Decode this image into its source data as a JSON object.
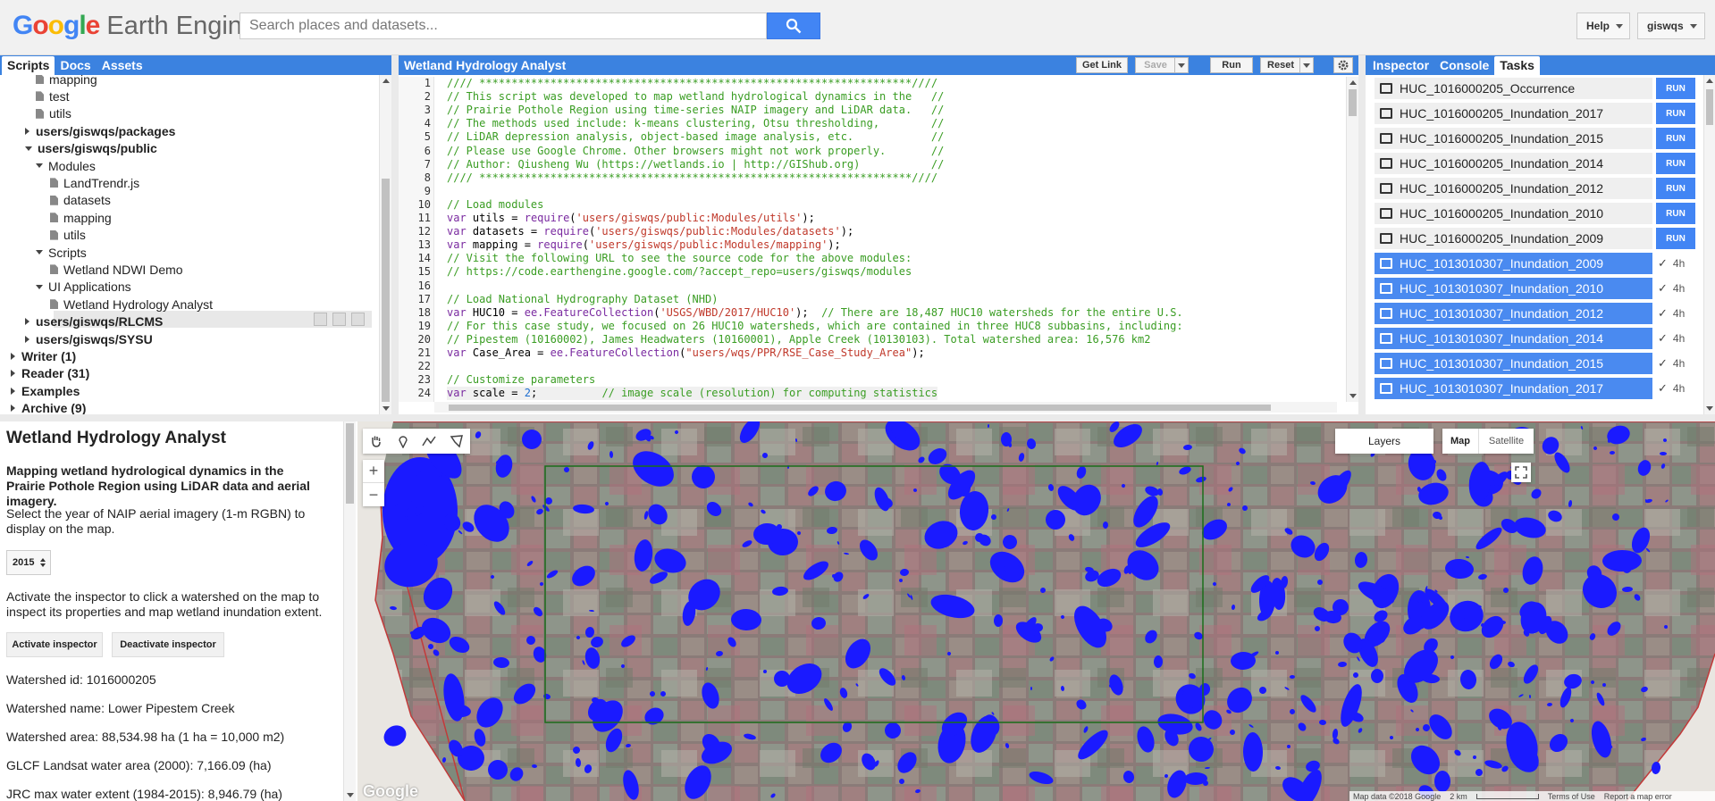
{
  "app": {
    "logo_google": "Google",
    "logo_product": "Earth Engine",
    "search_placeholder": "Search places and datasets...",
    "help_label": "Help",
    "user_label": "giswqs"
  },
  "left_panel": {
    "tabs": [
      "Scripts",
      "Docs",
      "Assets"
    ],
    "tree": [
      {
        "label": "mapping",
        "kind": "file",
        "depth": 3,
        "bold": false
      },
      {
        "label": "test",
        "kind": "file",
        "depth": 3,
        "bold": false
      },
      {
        "label": "utils",
        "kind": "file",
        "depth": 3,
        "bold": false
      },
      {
        "label": "users/giswqs/packages",
        "kind": "collapsed",
        "depth": 2,
        "bold": true
      },
      {
        "label": "users/giswqs/public",
        "kind": "expanded",
        "depth": 2,
        "bold": true
      },
      {
        "label": "Modules",
        "kind": "expanded",
        "depth": 3,
        "bold": false
      },
      {
        "label": "LandTrendr.js",
        "kind": "file",
        "depth": 4,
        "bold": false
      },
      {
        "label": "datasets",
        "kind": "file",
        "depth": 4,
        "bold": false
      },
      {
        "label": "mapping",
        "kind": "file",
        "depth": 4,
        "bold": false
      },
      {
        "label": "utils",
        "kind": "file",
        "depth": 4,
        "bold": false
      },
      {
        "label": "Scripts",
        "kind": "expanded",
        "depth": 3,
        "bold": false
      },
      {
        "label": "Wetland NDWI Demo",
        "kind": "file",
        "depth": 4,
        "bold": false
      },
      {
        "label": "UI Applications",
        "kind": "expanded",
        "depth": 3,
        "bold": false
      },
      {
        "label": "Wetland Hydrology Analyst",
        "kind": "file",
        "depth": 4,
        "bold": false
      },
      {
        "label": "users/giswqs/RLCMS",
        "kind": "collapsed",
        "depth": 2,
        "bold": true
      },
      {
        "label": "users/giswqs/SYSU",
        "kind": "collapsed",
        "depth": 2,
        "bold": true
      },
      {
        "label": "Writer (1)",
        "kind": "collapsed",
        "depth": 1,
        "bold": true
      },
      {
        "label": "Reader (31)",
        "kind": "collapsed",
        "depth": 1,
        "bold": true
      },
      {
        "label": "Examples",
        "kind": "collapsed",
        "depth": 1,
        "bold": true
      },
      {
        "label": "Archive (9)",
        "kind": "collapsed",
        "depth": 1,
        "bold": true
      }
    ]
  },
  "editor": {
    "title": "Wetland Hydrology Analyst",
    "get_link": "Get Link",
    "save": "Save",
    "run": "Run",
    "reset": "Reset",
    "current_line": 24,
    "lines": [
      "//// *******************************************************************////",
      "// This script was developed to map wetland hydrological dynamics in the   //",
      "// Prairie Pothole Region using time-series NAIP imagery and LiDAR data.   //",
      "// The methods used include: k-means clustering, Otsu thresholding,        //",
      "// LiDAR depression analysis, object-based image analysis, etc.            //",
      "// Please use Google Chrome. Other browsers might not work properly.       //",
      "// Author: Qiusheng Wu (https://wetlands.io | http://GIShub.org)           //",
      "//// *******************************************************************////",
      "",
      "// Load modules",
      "var utils = require('users/giswqs/public:Modules/utils');",
      "var datasets = require('users/giswqs/public:Modules/datasets');",
      "var mapping = require('users/giswqs/public:Modules/mapping');",
      "// Visit the following URL to see the source code for the above modules:",
      "// https://code.earthengine.google.com/?accept_repo=users/giswqs/modules",
      "",
      "// Load National Hydrography Dataset (NHD)",
      "var HUC10 = ee.FeatureCollection('USGS/WBD/2017/HUC10');  // There are 18,487 HUC10 watersheds for the entire U.S.",
      "// For this case study, we focused on 26 HUC10 watersheds, which are contained in three HUC8 subbasins, including:",
      "// Pipestem (10160002), James Headwaters (10160001), Apple Creek (10130103). Total watershed area: 16,576 km2",
      "var Case_Area = ee.FeatureCollection(\"users/wqs/PPR/RSE_Case_Study_Area\");",
      "",
      "// Customize parameters",
      "var scale = 2;          // image scale (resolution) for computing statistics",
      ""
    ]
  },
  "right_panel": {
    "tabs": [
      "Inspector",
      "Console",
      "Tasks"
    ],
    "tasks": [
      {
        "name": "HUC_1016000205_Occurrence",
        "state": "pending",
        "action": "RUN"
      },
      {
        "name": "HUC_1016000205_Inundation_2017",
        "state": "pending",
        "action": "RUN"
      },
      {
        "name": "HUC_1016000205_Inundation_2015",
        "state": "pending",
        "action": "RUN"
      },
      {
        "name": "HUC_1016000205_Inundation_2014",
        "state": "pending",
        "action": "RUN"
      },
      {
        "name": "HUC_1016000205_Inundation_2012",
        "state": "pending",
        "action": "RUN"
      },
      {
        "name": "HUC_1016000205_Inundation_2010",
        "state": "pending",
        "action": "RUN"
      },
      {
        "name": "HUC_1016000205_Inundation_2009",
        "state": "pending",
        "action": "RUN"
      },
      {
        "name": "HUC_1013010307_Inundation_2009",
        "state": "done",
        "action": "4h"
      },
      {
        "name": "HUC_1013010307_Inundation_2010",
        "state": "done",
        "action": "4h"
      },
      {
        "name": "HUC_1013010307_Inundation_2012",
        "state": "done",
        "action": "4h"
      },
      {
        "name": "HUC_1013010307_Inundation_2014",
        "state": "done",
        "action": "4h"
      },
      {
        "name": "HUC_1013010307_Inundation_2015",
        "state": "done",
        "action": "4h"
      },
      {
        "name": "HUC_1013010307_Inundation_2017",
        "state": "done",
        "action": "4h"
      }
    ]
  },
  "ui_panel": {
    "title": "Wetland Hydrology Analyst",
    "subtitle": "Mapping wetland hydrological dynamics in the Prairie Pothole Region using LiDAR data and aerial imagery.",
    "year_prompt": "Select the year of NAIP aerial imagery (1-m RGBN) to display on the map.",
    "year_value": "2015",
    "inspector_prompt": "Activate the inspector to click a watershed on the map to inspect its properties and map wetland inundation extent.",
    "activate_label": "Activate inspector",
    "deactivate_label": "Deactivate inspector",
    "watershed_id": "Watershed id: 1016000205",
    "watershed_name": "Watershed name: Lower Pipestem Creek",
    "watershed_area": "Watershed area: 88,534.98 ha (1 ha = 10,000 m2)",
    "glcf_area": "GLCF Landsat water area (2000): 7,166.09 (ha)",
    "jrc_area": "JRC max water extent (1984-2015): 8,946.79 (ha)"
  },
  "map": {
    "layers_label": "Layers",
    "map_label": "Map",
    "satellite_label": "Satellite",
    "zoom_in": "+",
    "zoom_out": "−",
    "attribution": "Map data ©2018 Google",
    "scale_label": "2 km",
    "terms": "Terms of Use",
    "report": "Report a map error",
    "google_watermark": "Google",
    "colors": {
      "water": "#1a1aff",
      "boundary": "#cc2a2a",
      "case_area": "#1a6e1a",
      "land": "#8d7f78"
    }
  }
}
